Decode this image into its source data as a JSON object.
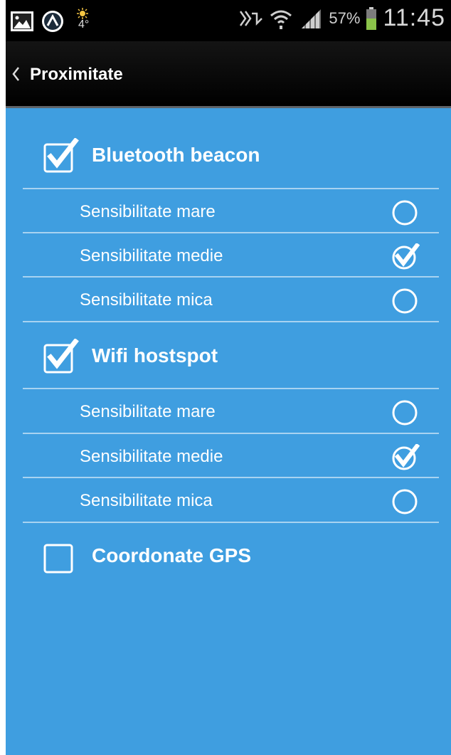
{
  "status_bar": {
    "temperature": "4°",
    "battery_percent": "57%",
    "time": "11:45"
  },
  "app_bar": {
    "title": "Proximitate"
  },
  "groups": [
    {
      "title": "Bluetooth beacon",
      "checked": true,
      "options": [
        {
          "label": "Sensibilitate mare",
          "selected": false
        },
        {
          "label": "Sensibilitate medie",
          "selected": true
        },
        {
          "label": "Sensibilitate mica",
          "selected": false
        }
      ]
    },
    {
      "title": "Wifi hostspot",
      "checked": true,
      "options": [
        {
          "label": "Sensibilitate mare",
          "selected": false
        },
        {
          "label": "Sensibilitate medie",
          "selected": true
        },
        {
          "label": "Sensibilitate mica",
          "selected": false
        }
      ]
    },
    {
      "title": "Coordonate GPS",
      "checked": false,
      "options": []
    }
  ],
  "colors": {
    "background": "#3f9ee0",
    "text": "#ffffff",
    "battery": "#8bc34a"
  }
}
